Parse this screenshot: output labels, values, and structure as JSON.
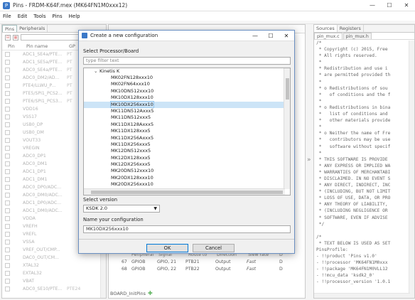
{
  "window": {
    "title": "Pins - FRDM-K64F.mex (MK64FN1M0xxx12)",
    "minimize": "—",
    "maximize": "☐",
    "close": "✕"
  },
  "menu": [
    "File",
    "Edit",
    "Tools",
    "Pins",
    "Help"
  ],
  "left_panel": {
    "tabs": [
      "Pins",
      "Peripherals"
    ],
    "columns": [
      "Pin",
      "Pin name",
      "GP"
    ],
    "rows": [
      {
        "num": "1",
        "name": "ADC1_SE4a/PTE...",
        "gp": "PT"
      },
      {
        "num": "2",
        "name": "ADC1_SE5a/PTE...",
        "gp": "PT"
      },
      {
        "num": "3",
        "name": "ADC0_SE4a/PTE...",
        "gp": "PT"
      },
      {
        "num": "4",
        "name": "ADC0_DM2/AD...",
        "gp": "PT"
      },
      {
        "num": "5",
        "name": "PTE4/LLWU_P...",
        "gp": "PT"
      },
      {
        "num": "6",
        "name": "PTE5/SPI1_PCS2...",
        "gp": "PT"
      },
      {
        "num": "7",
        "name": "PTE6/SPI1_PCS3...",
        "gp": "PT"
      },
      {
        "num": "8",
        "name": "VDD16",
        "gp": ""
      },
      {
        "num": "9",
        "name": "VSS17",
        "gp": ""
      },
      {
        "num": "10",
        "name": "USB0_DP",
        "gp": ""
      },
      {
        "num": "11",
        "name": "USB0_DM",
        "gp": ""
      },
      {
        "num": "12",
        "name": "VOUT33",
        "gp": ""
      },
      {
        "num": "13",
        "name": "VREGIN",
        "gp": ""
      },
      {
        "num": "14",
        "name": "ADC0_DP1",
        "gp": ""
      },
      {
        "num": "15",
        "name": "ADC0_DM1",
        "gp": ""
      },
      {
        "num": "16",
        "name": "ADC1_DP1",
        "gp": ""
      },
      {
        "num": "17",
        "name": "ADC1_DM1",
        "gp": ""
      },
      {
        "num": "18",
        "name": "ADC0_DP0/ADC...",
        "gp": ""
      },
      {
        "num": "19",
        "name": "ADC0_DM0/ADC...",
        "gp": ""
      },
      {
        "num": "20",
        "name": "ADC1_DP0/ADC...",
        "gp": ""
      },
      {
        "num": "21",
        "name": "ADC1_DM0/ADC...",
        "gp": ""
      },
      {
        "num": "22",
        "name": "VDDA",
        "gp": ""
      },
      {
        "num": "23",
        "name": "VREFH",
        "gp": ""
      },
      {
        "num": "24",
        "name": "VREFL",
        "gp": ""
      },
      {
        "num": "25",
        "name": "VSSA",
        "gp": ""
      },
      {
        "num": "26",
        "name": "VREF_OUT/CMP...",
        "gp": ""
      },
      {
        "num": "27",
        "name": "DAC0_OUT/CM...",
        "gp": ""
      },
      {
        "num": "28",
        "name": "XTAL32",
        "gp": ""
      },
      {
        "num": "29",
        "name": "EXTAL32",
        "gp": ""
      },
      {
        "num": "30",
        "name": "VBAT",
        "gp": ""
      },
      {
        "num": "31",
        "name": "ADC0_SE10/PTE...",
        "gp": "PTE24"
      }
    ]
  },
  "center": {
    "routing_header": [
      "Peripheral",
      "Signal",
      "Route to",
      "Direction",
      "Slew rate",
      "D"
    ],
    "routing_rows": [
      {
        "num": "67",
        "peripheral": "GPIOB",
        "signal": "GPIO, 21",
        "route": "PTB21",
        "direction": "Output",
        "slew": "Fast",
        "d": "D"
      },
      {
        "num": "68",
        "peripheral": "GPIOB",
        "signal": "GPIO, 22",
        "route": "PTB22",
        "direction": "Output",
        "slew": "Fast",
        "d": "D"
      }
    ],
    "board_tab": "BOARD_InitPins",
    "arrows": "»"
  },
  "right_panel": {
    "tabs": [
      "Sources",
      "Registers"
    ],
    "file_tabs": [
      "pin_mux.c",
      "pin_mux.h"
    ],
    "code_lines": [
      "/*",
      " * Copyright (c) 2015, Free",
      " * All rights reserved.",
      " *",
      " * Redistribution and use i",
      " * are permitted provided th",
      " *",
      " * o Redistributions of sou",
      " *   of conditions and the f",
      " *",
      " * o Redistributions in bina",
      " *   list of conditions and",
      " *   other materials provide",
      " *",
      " * o Neither the name of Fre",
      " *   contributors may be use",
      " *   software without specif",
      " *",
      " * THIS SOFTWARE IS PROVIDE",
      " * ANY EXPRESS OR IMPLIED WA",
      " * WARRANTIES OF MERCHANTABI",
      " * DISCLAIMED. IN NO EVENT S",
      " * ANY DIRECT, INDIRECT, INC",
      " * (INCLUDING, BUT NOT LIMIT",
      " * LOSS OF USE, DATA, OR PRO",
      " * ANY THEORY OF LIABILITY,",
      " * (INCLUDING NEGLIGENCE OR",
      " * SOFTWARE, EVEN IF ADVISE",
      " */",
      "",
      "/*",
      " * TEXT BELOW IS USED AS SET",
      "PinsProfile:",
      "- !!product 'Pins v1.0'",
      "- !!processor 'MK64FN1M0xxx",
      "- !!package 'MK64FN1M0VLL12",
      "- !!mcu_data 'ksdk2_0'",
      "- !!processor_version '1.0.1"
    ]
  },
  "dialog": {
    "title": "Create a new configuration",
    "minimize": "—",
    "maximize": "☐",
    "close": "✕",
    "select_label": "Select Processor/Board",
    "filter_placeholder": "type filter text",
    "tree_root": "Kinetis K",
    "tree_items": [
      "MK02FN128xxx10",
      "MK02FN64xxx10",
      "MK10DN512xxx10",
      "MK10DX128xxx10",
      "MK10DX256xxx10",
      "MK11DN512Axxx5",
      "MK11DN512xxx5",
      "MK11DX128Axxx5",
      "MK11DX128xxx5",
      "MK11DX256Axxx5",
      "MK11DX256xxx5",
      "MK12DN512xxx5",
      "MK12DX128xxx5",
      "MK12DX256xxx5",
      "MK20DN512xxx10",
      "MK20DX128xxx10",
      "MK20DX256xxx10"
    ],
    "selected_index": 4,
    "version_label": "Select version",
    "version_value": "KSDK 2.0",
    "name_label": "Name your configuration",
    "name_value": "MK10DX256xxx10",
    "ok_label": "OK",
    "cancel_label": "Cancel"
  }
}
